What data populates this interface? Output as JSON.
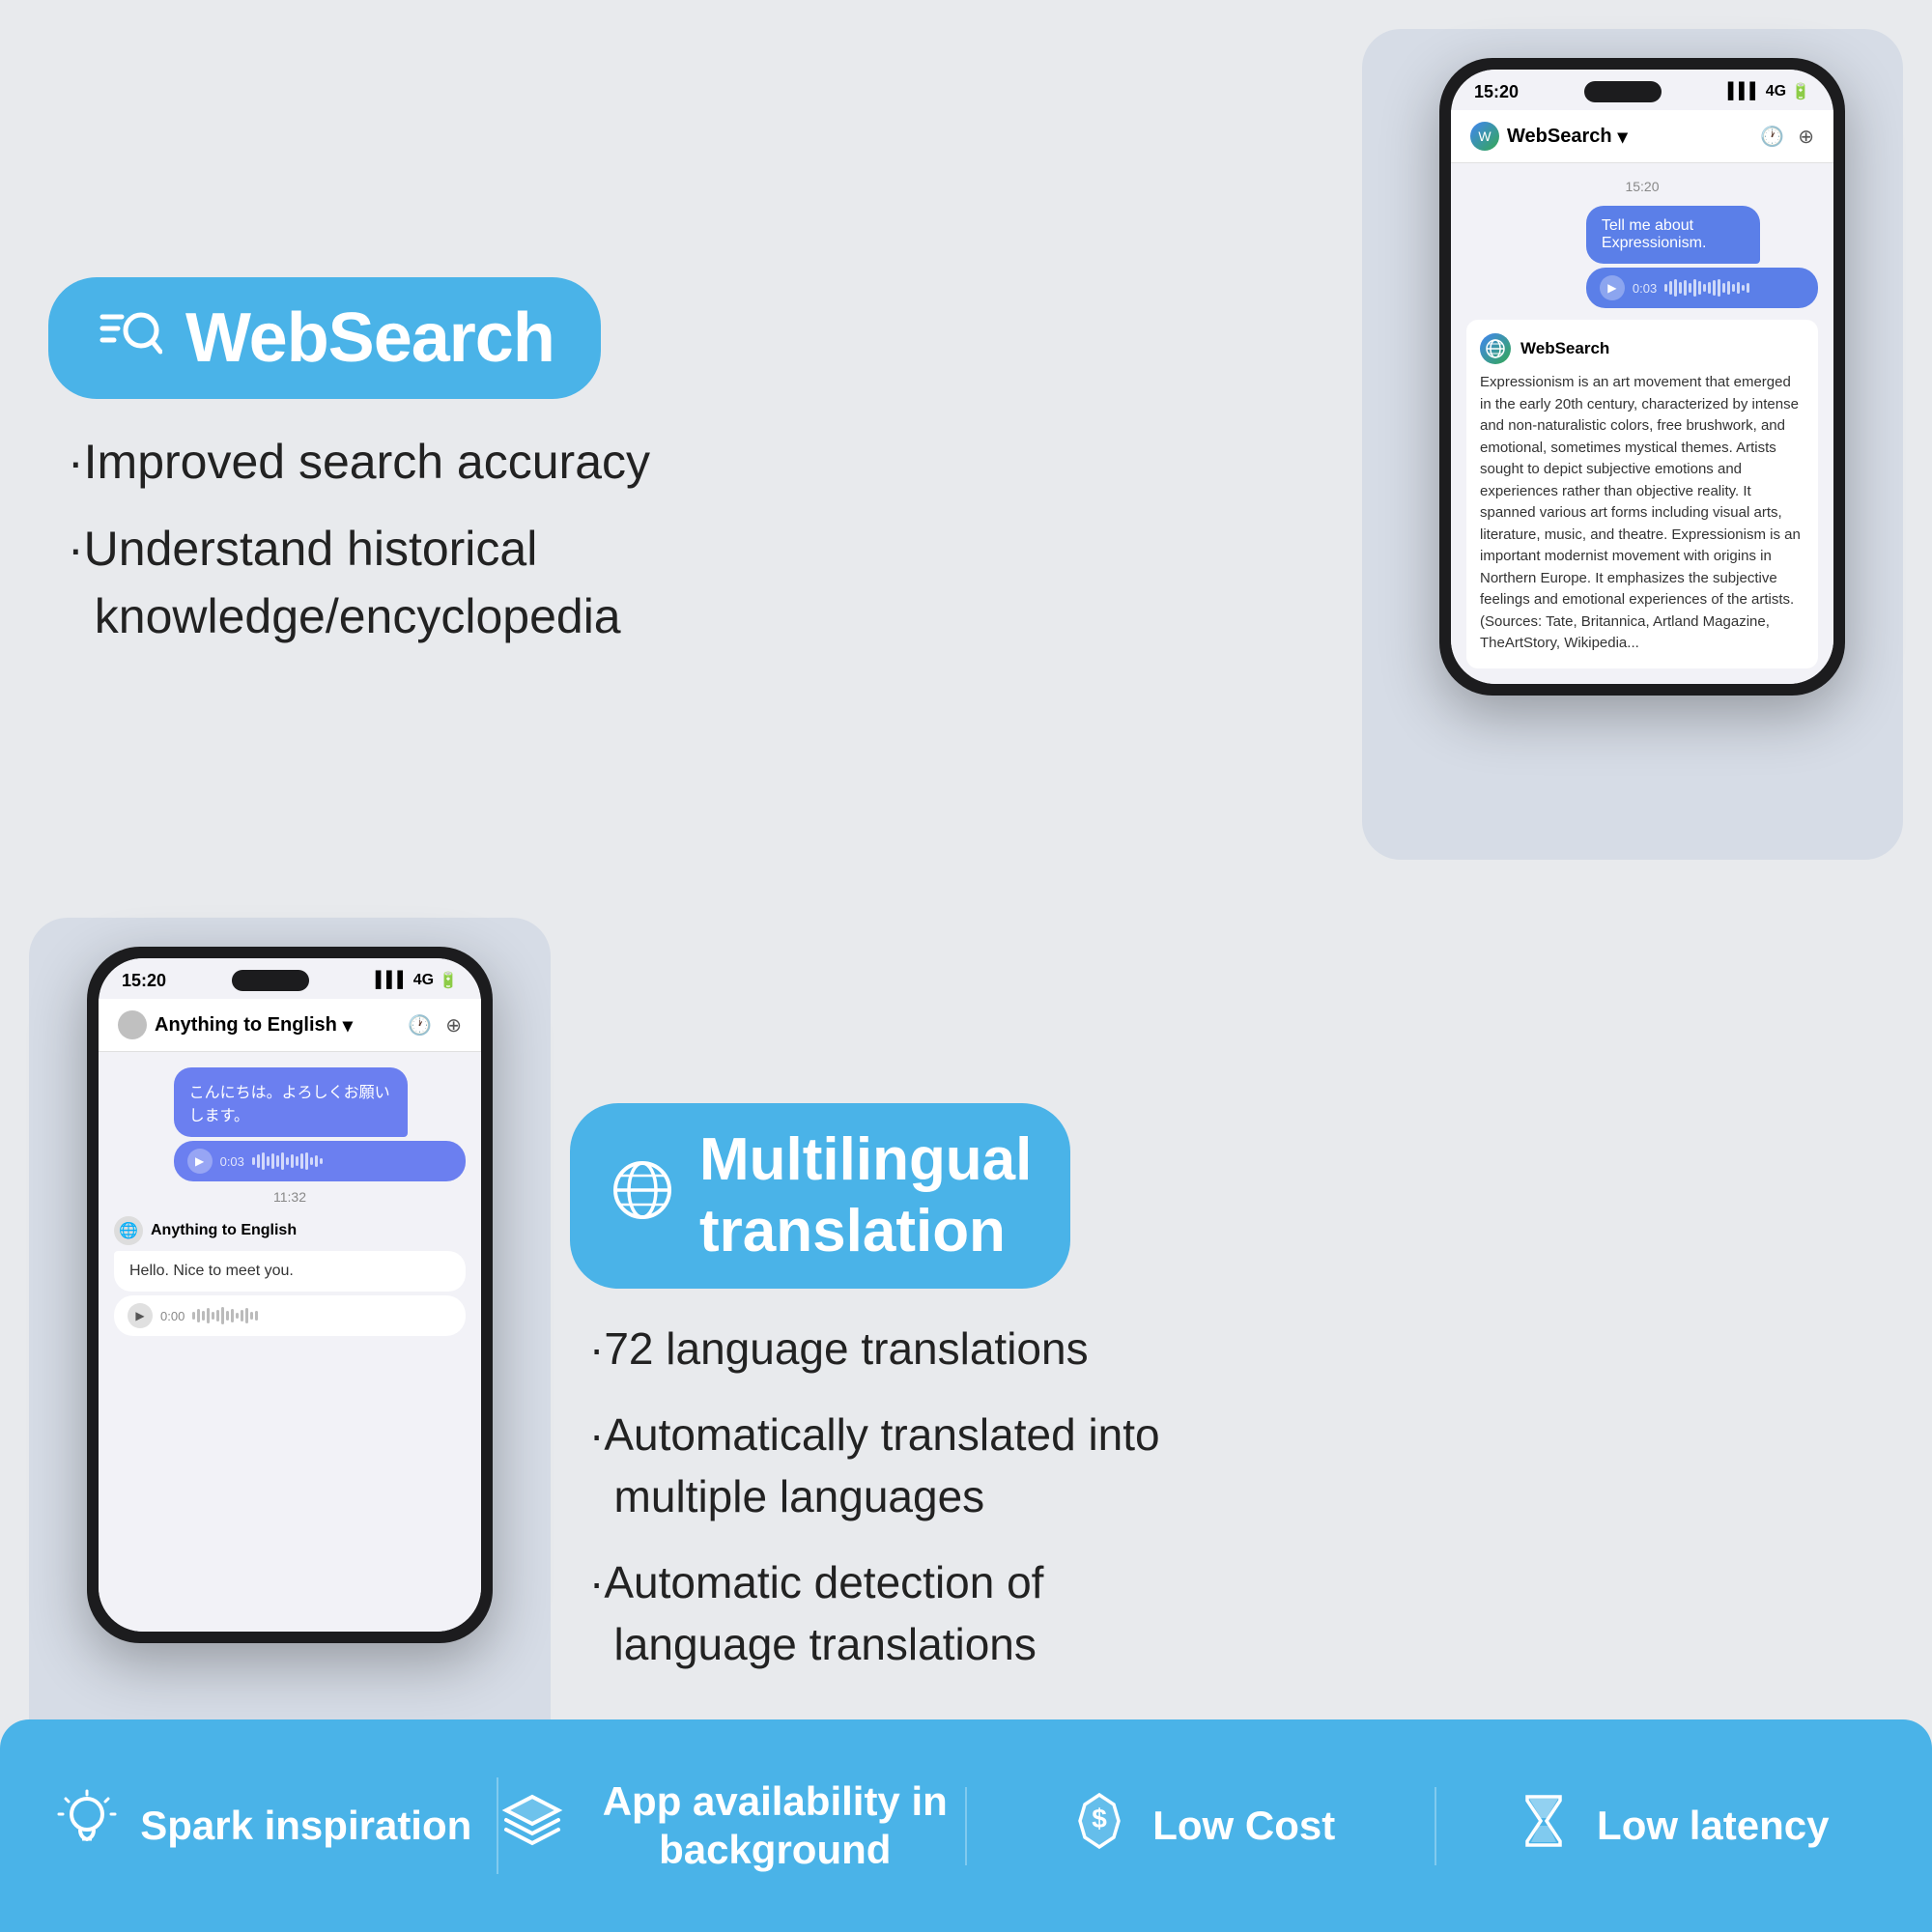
{
  "websearch": {
    "badge_label": "WebSearch",
    "feature1": "·Improved search accuracy",
    "feature2": "·Understand historical\n  knowledge/encyclopedia"
  },
  "phone1": {
    "status_time": "15:20",
    "status_signal": "▌▌▌ 4G",
    "header_title": "WebSearch",
    "header_dropdown": "▾",
    "chat_timestamp": "15:20",
    "user_message": "Tell me about Expressionism.",
    "audio_time": "0:03",
    "response_name": "WebSearch",
    "response_text": "Expressionism is an art movement that emerged in the early 20th century, characterized by intense and non-naturalistic colors, free brushwork, and emotional, sometimes mystical themes. Artists sought to depict subjective emotions and experiences rather than objective reality. It spanned various art forms including visual arts, literature, music, and theatre. Expressionism is an important modernist movement with origins in Northern Europe. It emphasizes the subjective feelings and emotional experiences of the artists. (Sources: Tate, Britannica, Artland Magazine, TheArtStory, Wikipedia..."
  },
  "phone2": {
    "status_time": "15:20",
    "status_signal": "▌▌▌ 4G",
    "header_title": "Anything to English",
    "header_dropdown": "▾",
    "chat_timestamp": "11:32",
    "user_message_jp": "こんにちは。よろしくお願いします。",
    "audio_time_user": "0:03",
    "response_name": "Anything to English",
    "response_text_en": "Hello. Nice to meet you.",
    "audio_time_response": "0:00"
  },
  "multilingual": {
    "badge_label1": "Multilingual",
    "badge_label2": "translation",
    "feature1": "·72 language translations",
    "feature2": "·Automatically translated into\n  multiple languages",
    "feature3": "·Automatic detection of\n  language translations"
  },
  "bottom_bar": {
    "item1_label": "Spark\ninspiration",
    "item2_label": "App availability\nin background",
    "item3_label": "Low\nCost",
    "item4_label": "Low\nlatency"
  }
}
